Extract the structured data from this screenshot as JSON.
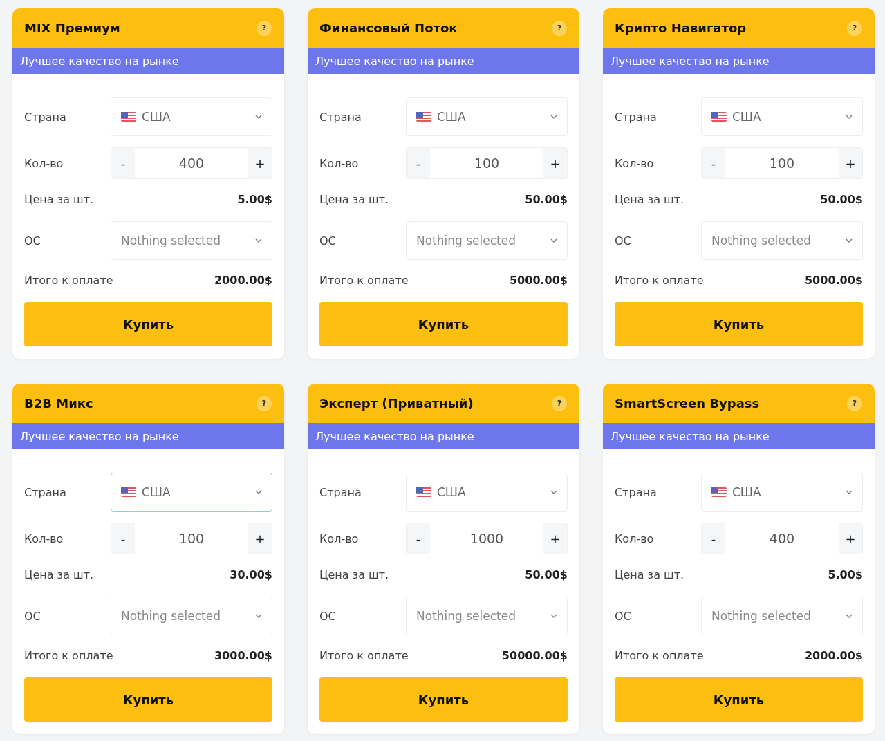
{
  "cards": [
    {
      "title": "MIX Премиум",
      "help": "?",
      "subtitle": "Лучшее качество на рынке",
      "country": {
        "label": "Страна",
        "value": "США",
        "focused": false
      },
      "quantity": {
        "label": "Кол-во",
        "minus": "-",
        "value": "400",
        "plus": "+"
      },
      "price": {
        "label": "Цена за шт.",
        "value": "5.00$"
      },
      "os": {
        "label": "ОС",
        "placeholder": "Nothing selected"
      },
      "total": {
        "label": "Итого к оплате",
        "value": "2000.00$"
      },
      "button": "Купить"
    },
    {
      "title": "Финансовый Поток",
      "help": "?",
      "subtitle": "Лучшее качество на рынке",
      "country": {
        "label": "Страна",
        "value": "США",
        "focused": false
      },
      "quantity": {
        "label": "Кол-во",
        "minus": "-",
        "value": "100",
        "plus": "+"
      },
      "price": {
        "label": "Цена за шт.",
        "value": "50.00$"
      },
      "os": {
        "label": "ОС",
        "placeholder": "Nothing selected"
      },
      "total": {
        "label": "Итого к оплате",
        "value": "5000.00$"
      },
      "button": "Купить"
    },
    {
      "title": "Крипто Навигатор",
      "help": "?",
      "subtitle": "Лучшее качество на рынке",
      "country": {
        "label": "Страна",
        "value": "США",
        "focused": false
      },
      "quantity": {
        "label": "Кол-во",
        "minus": "-",
        "value": "100",
        "plus": "+"
      },
      "price": {
        "label": "Цена за шт.",
        "value": "50.00$"
      },
      "os": {
        "label": "ОС",
        "placeholder": "Nothing selected"
      },
      "total": {
        "label": "Итого к оплате",
        "value": "5000.00$"
      },
      "button": "Купить"
    },
    {
      "title": "B2B Микс",
      "help": "?",
      "subtitle": "Лучшее качество на рынке",
      "country": {
        "label": "Страна",
        "value": "США",
        "focused": true
      },
      "quantity": {
        "label": "Кол-во",
        "minus": "-",
        "value": "100",
        "plus": "+"
      },
      "price": {
        "label": "Цена за шт.",
        "value": "30.00$"
      },
      "os": {
        "label": "ОС",
        "placeholder": "Nothing selected"
      },
      "total": {
        "label": "Итого к оплате",
        "value": "3000.00$"
      },
      "button": "Купить"
    },
    {
      "title": "Эксперт (Приватный)",
      "help": "?",
      "subtitle": "Лучшее качество на рынке",
      "country": {
        "label": "Страна",
        "value": "США",
        "focused": false
      },
      "quantity": {
        "label": "Кол-во",
        "minus": "-",
        "value": "1000",
        "plus": "+"
      },
      "price": {
        "label": "Цена за шт.",
        "value": "50.00$"
      },
      "os": {
        "label": "ОС",
        "placeholder": "Nothing selected"
      },
      "total": {
        "label": "Итого к оплате",
        "value": "50000.00$"
      },
      "button": "Купить"
    },
    {
      "title": "SmartScreen Bypass",
      "help": "?",
      "subtitle": "Лучшее качество на рынке",
      "country": {
        "label": "Страна",
        "value": "США",
        "focused": false
      },
      "quantity": {
        "label": "Кол-во",
        "minus": "-",
        "value": "400",
        "plus": "+"
      },
      "price": {
        "label": "Цена за шт.",
        "value": "5.00$"
      },
      "os": {
        "label": "ОС",
        "placeholder": "Nothing selected"
      },
      "total": {
        "label": "Итого к оплате",
        "value": "2000.00$"
      },
      "button": "Купить"
    }
  ]
}
